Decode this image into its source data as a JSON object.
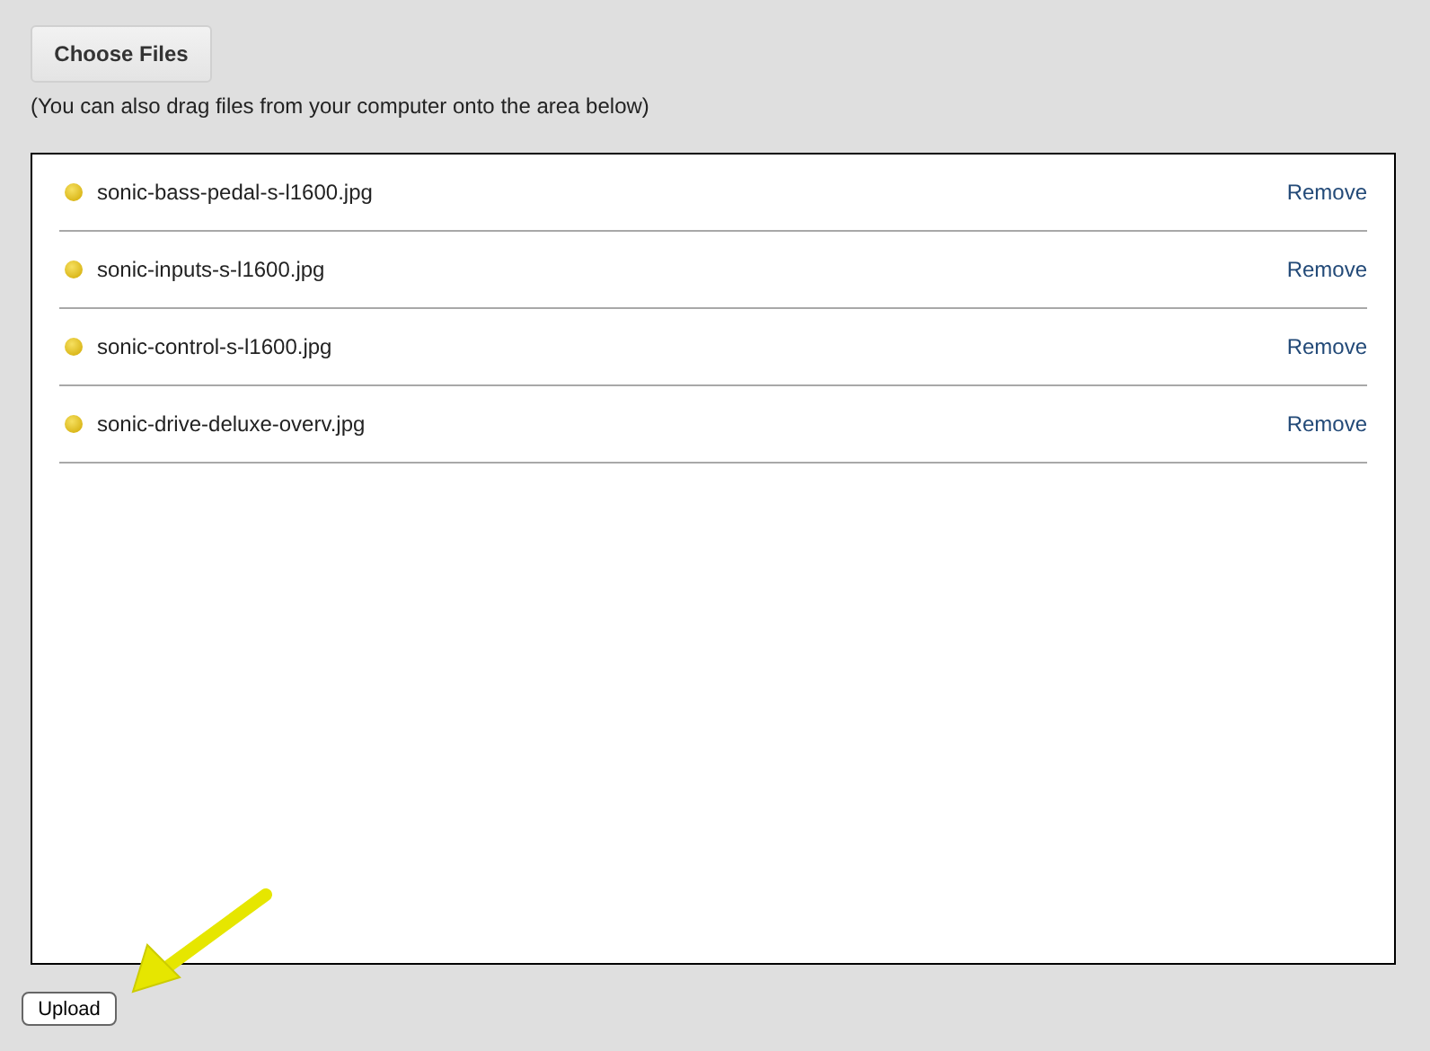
{
  "choose_button": {
    "label": "Choose Files"
  },
  "hint": "(You can also drag files from your computer onto the area below)",
  "files": [
    {
      "name": "sonic-bass-pedal-s-l1600.jpg",
      "action": "Remove"
    },
    {
      "name": "sonic-inputs-s-l1600.jpg",
      "action": "Remove"
    },
    {
      "name": "sonic-control-s-l1600.jpg",
      "action": "Remove"
    },
    {
      "name": "sonic-drive-deluxe-overv.jpg",
      "action": "Remove"
    }
  ],
  "upload_button": {
    "label": "Upload"
  }
}
